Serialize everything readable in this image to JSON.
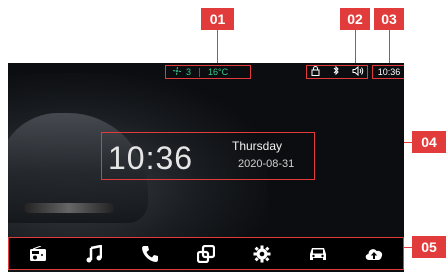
{
  "status_bar": {
    "fan_level": "3",
    "temperature": "16°C",
    "time": "10:36"
  },
  "clock": {
    "time": "10:36",
    "weekday": "Thursday",
    "date": "2020-08-31"
  },
  "annotations": {
    "a1": "01",
    "a2": "02",
    "a3": "03",
    "a4": "04",
    "a5": "05"
  },
  "colors": {
    "accent": "#e23b3b",
    "status_green": "#38c98c",
    "screen_bg": "#0b0d10"
  },
  "dock_icons": [
    "radio-icon",
    "music-icon",
    "phone-icon",
    "apps-icon",
    "settings-icon",
    "car-icon",
    "cloud-upload-icon"
  ]
}
